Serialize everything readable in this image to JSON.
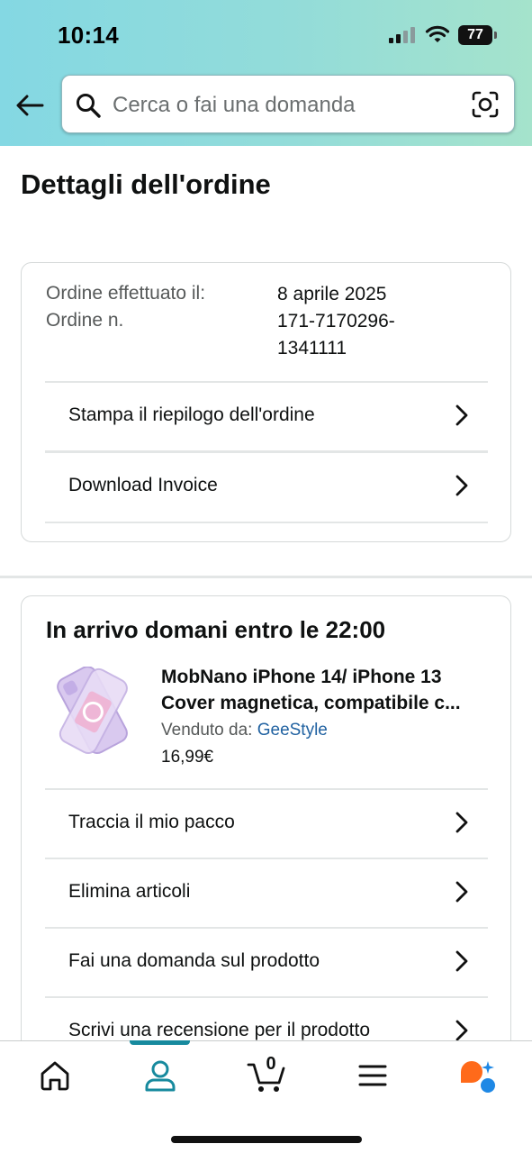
{
  "status_bar": {
    "time": "10:14",
    "battery": "77",
    "icons": [
      "signal-icon",
      "wifi-icon",
      "battery-icon"
    ]
  },
  "header": {
    "back_icon": "back-arrow-icon",
    "search": {
      "placeholder": "Cerca o fai una domanda",
      "search_icon": "search-icon",
      "camera_icon": "camera-scan-icon"
    },
    "colors": {
      "gradient_start": "#84d8e3",
      "gradient_end": "#a5e3cc"
    }
  },
  "page": {
    "title": "Dettagli dell'ordine"
  },
  "order_summary": {
    "placed_label": "Ordine effettuato il:",
    "placed_value": "8 aprile 2025",
    "number_label": "Ordine n.",
    "number_value": "171-7170296-1341111",
    "actions": [
      {
        "label": "Stampa il riepilogo dell'ordine",
        "icon": "chevron-right-icon"
      },
      {
        "label": "Download Invoice",
        "icon": "chevron-right-icon"
      }
    ]
  },
  "shipment": {
    "delivery_title": "In arrivo domani entro le 22:00",
    "product": {
      "title_line1": "MobNano iPhone 14/ iPhone 13",
      "title_line2": "Cover magnetica, compatibile c...",
      "sold_by_label": "Venduto da:",
      "seller": "GeeStyle",
      "price": "16,99€"
    },
    "actions": [
      {
        "label": "Traccia il mio pacco",
        "icon": "chevron-right-icon"
      },
      {
        "label": "Elimina articoli",
        "icon": "chevron-right-icon"
      },
      {
        "label": "Fai una domanda sul prodotto",
        "icon": "chevron-right-icon"
      },
      {
        "label": "Scrivi una recensione per il prodotto",
        "icon": "chevron-right-icon"
      }
    ],
    "colors": {
      "link": "#2162a1"
    }
  },
  "bottom_nav": {
    "items": [
      "home-icon",
      "account-icon",
      "cart-icon",
      "menu-icon",
      "assistant-icon"
    ],
    "active": "account-icon",
    "cart_count": "0",
    "colors": {
      "active": "#178a9e",
      "assistant_orange": "#ff6a1a",
      "assistant_blue": "#1e88e5"
    }
  }
}
